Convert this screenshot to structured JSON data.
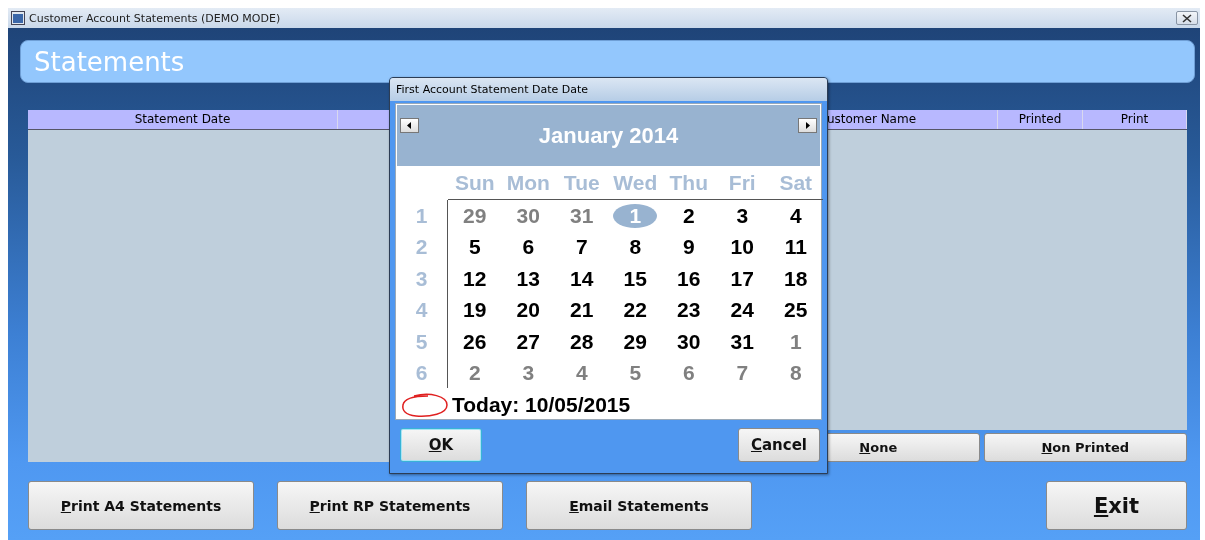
{
  "window": {
    "title": "Customer Account Statements (DEMO MODE)"
  },
  "header": {
    "title": "Statements"
  },
  "table": {
    "columns": [
      {
        "label": "Statement Date"
      },
      {},
      {
        "label": "ustomer Name"
      },
      {
        "label": "Printed"
      },
      {
        "label": "Print"
      }
    ]
  },
  "filter_buttons": [
    "None",
    "Non Printed"
  ],
  "buttons": [
    "Print A4 Statements",
    "Print RP Statements",
    "Email Statements"
  ],
  "exit_button": "Exit",
  "dialog": {
    "title": "First Account Statement Date Date",
    "month": "January 2014",
    "weekdays": [
      "Sun",
      "Mon",
      "Tue",
      "Wed",
      "Thu",
      "Fri",
      "Sat"
    ],
    "weeks": [
      {
        "number": "1",
        "days": [
          {
            "label": "29",
            "other_month": true,
            "selected": false
          },
          {
            "label": "30",
            "other_month": true,
            "selected": false
          },
          {
            "label": "31",
            "other_month": true,
            "selected": false
          },
          {
            "label": "1",
            "other_month": false,
            "selected": true
          },
          {
            "label": "2",
            "other_month": false,
            "selected": false
          },
          {
            "label": "3",
            "other_month": false,
            "selected": false
          },
          {
            "label": "4",
            "other_month": false,
            "selected": false
          }
        ]
      },
      {
        "number": "2",
        "days": [
          {
            "label": "5",
            "other_month": false,
            "selected": false
          },
          {
            "label": "6",
            "other_month": false,
            "selected": false
          },
          {
            "label": "7",
            "other_month": false,
            "selected": false
          },
          {
            "label": "8",
            "other_month": false,
            "selected": false
          },
          {
            "label": "9",
            "other_month": false,
            "selected": false
          },
          {
            "label": "10",
            "other_month": false,
            "selected": false
          },
          {
            "label": "11",
            "other_month": false,
            "selected": false
          }
        ]
      },
      {
        "number": "3",
        "days": [
          {
            "label": "12",
            "other_month": false,
            "selected": false
          },
          {
            "label": "13",
            "other_month": false,
            "selected": false
          },
          {
            "label": "14",
            "other_month": false,
            "selected": false
          },
          {
            "label": "15",
            "other_month": false,
            "selected": false
          },
          {
            "label": "16",
            "other_month": false,
            "selected": false
          },
          {
            "label": "17",
            "other_month": false,
            "selected": false
          },
          {
            "label": "18",
            "other_month": false,
            "selected": false
          }
        ]
      },
      {
        "number": "4",
        "days": [
          {
            "label": "19",
            "other_month": false,
            "selected": false
          },
          {
            "label": "20",
            "other_month": false,
            "selected": false
          },
          {
            "label": "21",
            "other_month": false,
            "selected": false
          },
          {
            "label": "22",
            "other_month": false,
            "selected": false
          },
          {
            "label": "23",
            "other_month": false,
            "selected": false
          },
          {
            "label": "24",
            "other_month": false,
            "selected": false
          },
          {
            "label": "25",
            "other_month": false,
            "selected": false
          }
        ]
      },
      {
        "number": "5",
        "days": [
          {
            "label": "26",
            "other_month": false,
            "selected": false
          },
          {
            "label": "27",
            "other_month": false,
            "selected": false
          },
          {
            "label": "28",
            "other_month": false,
            "selected": false
          },
          {
            "label": "29",
            "other_month": false,
            "selected": false
          },
          {
            "label": "30",
            "other_month": false,
            "selected": false
          },
          {
            "label": "31",
            "other_month": false,
            "selected": false
          },
          {
            "label": "1",
            "other_month": true,
            "selected": false
          }
        ]
      },
      {
        "number": "6",
        "days": [
          {
            "label": "2",
            "other_month": true,
            "selected": false
          },
          {
            "label": "3",
            "other_month": true,
            "selected": false
          },
          {
            "label": "4",
            "other_month": true,
            "selected": false
          },
          {
            "label": "5",
            "other_month": true,
            "selected": false
          },
          {
            "label": "6",
            "other_month": true,
            "selected": false
          },
          {
            "label": "7",
            "other_month": true,
            "selected": false
          },
          {
            "label": "8",
            "other_month": true,
            "selected": false
          }
        ]
      }
    ],
    "today": "Today: 10/05/2015",
    "buttons": [
      "OK",
      "Cancel"
    ]
  }
}
